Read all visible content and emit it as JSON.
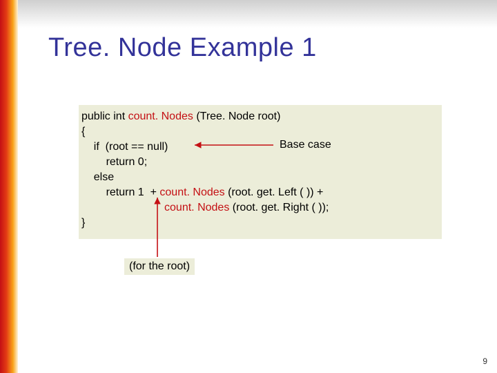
{
  "slide": {
    "title": "Tree. Node Example 1",
    "page_number": "9"
  },
  "code": {
    "l1a": "public int ",
    "l1b": "count. Nodes",
    "l1c": " (Tree. Node root)",
    "l2": "{",
    "l3": "    if  (root == null)",
    "l4": "        return 0;",
    "l5": "    else",
    "l6a": "        return 1  + ",
    "l6b": "count. Nodes",
    "l6c": " (root. get. Left ( )) +",
    "l7a": "                           ",
    "l7b": "count. Nodes",
    "l7c": " (root. get. Right ( ));",
    "l8": "}"
  },
  "annotations": {
    "base_case": "Base case",
    "for_root": "(for the root)"
  },
  "colors": {
    "title": "#333399",
    "call": "#c41014",
    "code_bg": "#ecedd9",
    "arrow": "#c41014"
  }
}
